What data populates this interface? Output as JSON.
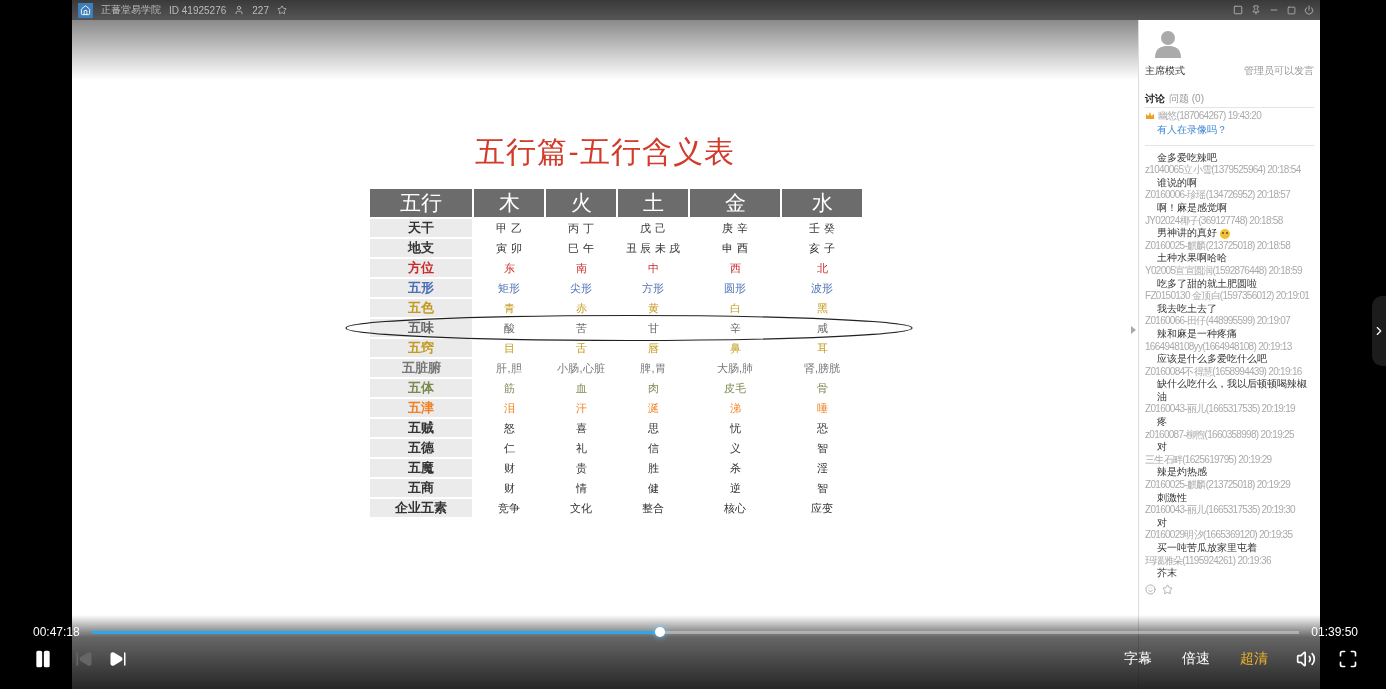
{
  "window": {
    "title": "正蕃堂易学院",
    "room_id": "ID 41925276",
    "viewers": "227"
  },
  "slide": {
    "title": "五行篇-五行含义表",
    "table": {
      "columns": [
        "五行",
        "木",
        "火",
        "土",
        "金",
        "水"
      ],
      "rows": [
        {
          "color": "#333333",
          "circled": false,
          "cells": [
            "天干",
            "甲 乙",
            "丙 丁",
            "戊 己",
            "庚 辛",
            "壬 癸"
          ]
        },
        {
          "color": "#333333",
          "circled": false,
          "cells": [
            "地支",
            "寅 卯",
            "巳 午",
            "丑 辰 未 戌",
            "申 酉",
            "亥 子"
          ]
        },
        {
          "color": "#cc2a2a",
          "circled": false,
          "cells": [
            "方位",
            "东",
            "南",
            "中",
            "西",
            "北"
          ]
        },
        {
          "color": "#4a6fb5",
          "circled": false,
          "cells": [
            "五形",
            "矩形",
            "尖形",
            "方形",
            "圆形",
            "波形"
          ]
        },
        {
          "color": "#c49a1c",
          "circled": false,
          "cells": [
            "五色",
            "青",
            "赤",
            "黄",
            "白",
            "黑"
          ]
        },
        {
          "color": "#666666",
          "circled": true,
          "cells": [
            "五味",
            "酸",
            "苦",
            "甘",
            "辛",
            "咸"
          ]
        },
        {
          "color": "#c49a1c",
          "circled": false,
          "cells": [
            "五窍",
            "目",
            "舌",
            "唇",
            "鼻",
            "耳"
          ]
        },
        {
          "color": "#777777",
          "circled": false,
          "cells": [
            "五脏腑",
            "肝,胆",
            "小肠,心脏",
            "脾,胃",
            "大肠,肺",
            "肾,膀胱"
          ]
        },
        {
          "color": "#7a8a50",
          "circled": false,
          "cells": [
            "五体",
            "筋",
            "血",
            "肉",
            "皮毛",
            "骨"
          ]
        },
        {
          "color": "#f08020",
          "circled": false,
          "cells": [
            "五津",
            "泪",
            "汗",
            "涎",
            "涕",
            "唾"
          ]
        },
        {
          "color": "#333333",
          "circled": false,
          "cells": [
            "五贼",
            "怒",
            "喜",
            "思",
            "忧",
            "恐"
          ]
        },
        {
          "color": "#333333",
          "circled": false,
          "cells": [
            "五德",
            "仁",
            "礼",
            "信",
            "义",
            "智"
          ]
        },
        {
          "color": "#333333",
          "circled": false,
          "cells": [
            "五魔",
            "财",
            "贵",
            "胜",
            "杀",
            "淫"
          ]
        },
        {
          "color": "#333333",
          "circled": false,
          "cells": [
            "五商",
            "财",
            "情",
            "健",
            "逆",
            "智"
          ]
        },
        {
          "color": "#333333",
          "circled": false,
          "cells": [
            "企业五素",
            "竞争",
            "文化",
            "整合",
            "核心",
            "应变"
          ]
        }
      ]
    }
  },
  "chat": {
    "mode": "主席模式",
    "permission": "管理员可以发言",
    "tabs": [
      {
        "label": "讨论",
        "selected": true
      },
      {
        "label": "问题",
        "count": "(0)",
        "selected": false
      }
    ],
    "pinned": {
      "meta": "幽悠(187064267) 19:43:20",
      "text": "有人在录像吗？"
    },
    "messages": [
      {
        "text": "金多爱吃辣吧",
        "meta": "z1040065立小雪(1379525964) 20:18:54"
      },
      {
        "text": "谁说的啊",
        "meta": "Z0160006-珍瑶(134726952) 20:18:57"
      },
      {
        "text": "啊！麻是感觉啊",
        "meta": "JY02024椰子(369127748) 20:18:58"
      },
      {
        "text": "男神讲的真好",
        "emoji": true,
        "meta": "Z0160025-麒麟(213725018) 20:18:58"
      },
      {
        "text": "土种水果啊哈哈",
        "meta": "Y02005宣宣圆润(1592876448) 20:18:59"
      },
      {
        "text": "吃多了甜的就土肥圆啦",
        "meta": "FZ0150130 金顶白(1597356012) 20:19:01"
      },
      {
        "text": "我去吃土去了",
        "meta": "Z0160066-田仔(448995599) 20:19:07"
      },
      {
        "text": "辣和麻是一种疼痛",
        "meta": "1664948108yy(1664948108) 20:19:13"
      },
      {
        "text": "应该是什么多爱吃什么吧",
        "meta": "Z0160084不得慧(1658994439) 20:19:16"
      },
      {
        "text": "缺什么吃什么，我以后顿顿喝辣椒油",
        "meta": "Z0160043-丽儿(1665317535) 20:19:19"
      },
      {
        "text": "疼",
        "meta": "z0160087-柳煦(1660358998) 20:19:25"
      },
      {
        "text": "对",
        "meta": "三生石畔(1625619795) 20:19:29"
      },
      {
        "text": "辣是灼热感",
        "meta": "Z0160025-麒麟(213725018) 20:19:29"
      },
      {
        "text": "刺激性",
        "meta": "Z0160043-丽儿(1665317535) 20:19:30"
      },
      {
        "text": "对",
        "meta": "Z0160029明汐(1665369120) 20:19:35"
      },
      {
        "text": "买一吨苦瓜放家里屯着",
        "meta": "玛瑙雅朵(1195924261) 20:19:36"
      },
      {
        "text": "芥末"
      }
    ]
  },
  "player": {
    "elapsed": "00:47:18",
    "duration": "01:39:50",
    "progress": {
      "level": 0.471
    },
    "prev": {
      "disabled": true
    },
    "options": [
      {
        "label": "字幕",
        "selected": false
      },
      {
        "label": "倍速",
        "selected": false
      },
      {
        "label": "超清",
        "selected": true
      }
    ]
  }
}
